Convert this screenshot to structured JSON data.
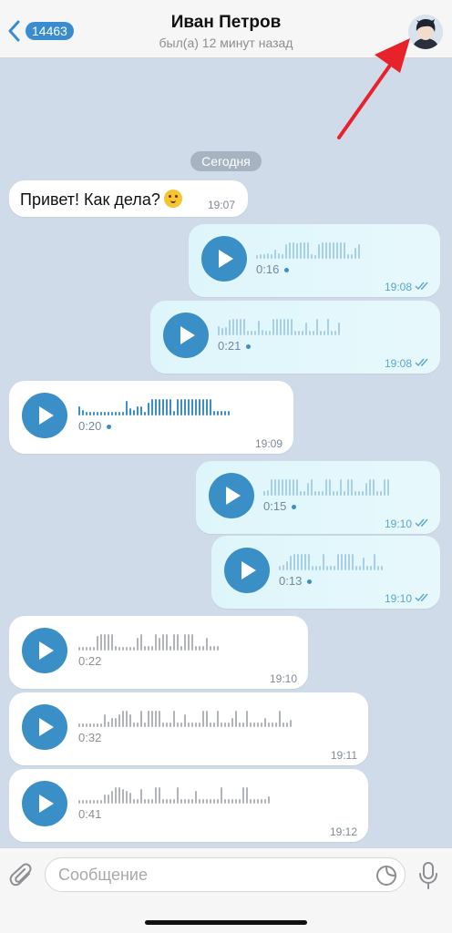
{
  "header": {
    "back_count": "14463",
    "name": "Иван Петров",
    "status": "был(а) 12 минут назад"
  },
  "date_separator": "Сегодня",
  "messages": [
    {
      "dir": "in",
      "type": "text",
      "text": "Привет! Как дела?",
      "emoji": "upside-down-face-emoji",
      "time": "19:07"
    },
    {
      "dir": "out",
      "type": "voice",
      "duration": "0:16",
      "time": "19:08",
      "read": true
    },
    {
      "dir": "out",
      "type": "voice",
      "duration": "0:21",
      "time": "19:08",
      "read": true
    },
    {
      "dir": "in",
      "type": "voice",
      "duration": "0:20",
      "time": "19:09"
    },
    {
      "dir": "out",
      "type": "voice",
      "duration": "0:15",
      "time": "19:10",
      "read": true
    },
    {
      "dir": "out",
      "type": "voice",
      "duration": "0:13",
      "time": "19:10",
      "read": true
    },
    {
      "dir": "in",
      "type": "voice",
      "duration": "0:22",
      "time": "19:10"
    },
    {
      "dir": "in",
      "type": "voice",
      "duration": "0:32",
      "time": "19:11"
    },
    {
      "dir": "in",
      "type": "voice",
      "duration": "0:41",
      "time": "19:12"
    }
  ],
  "input": {
    "placeholder": "Сообщение",
    "value": ""
  },
  "icons": [
    "chevron-left-icon",
    "avatar",
    "attach-icon",
    "sticker-icon",
    "microphone-icon",
    "play-icon"
  ],
  "colors": {
    "accent": "#3b8fc7",
    "background": "#cfdbe8",
    "outgoing_bubble": "#def6fb",
    "incoming_bubble": "#ffffff",
    "annotation_arrow": "#e8222b"
  }
}
